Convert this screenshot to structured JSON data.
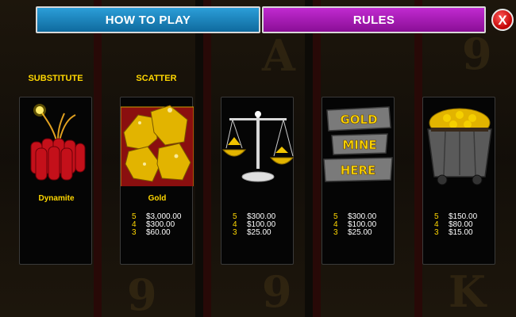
{
  "tabs": {
    "how_to_play": "HOW TO PLAY",
    "rules": "RULES"
  },
  "close_glyph": "X",
  "top_labels": {
    "substitute": "SUBSTITUTE",
    "scatter": "SCATTER"
  },
  "colors": {
    "gold_text": "#ffd700",
    "how_to_play_tab": "#1a86c2",
    "rules_tab": "#a11bb0",
    "close_button": "#d40000"
  },
  "cards": [
    {
      "symbol": "dynamite-icon",
      "name": "Dynamite",
      "pays": []
    },
    {
      "symbol": "gold-nugget-icon",
      "name": "Gold",
      "pays": [
        {
          "count": "5",
          "amount": "$3,000.00"
        },
        {
          "count": "4",
          "amount": "$300.00"
        },
        {
          "count": "3",
          "amount": "$60.00"
        }
      ]
    },
    {
      "symbol": "gold-scale-icon",
      "name": "",
      "pays": [
        {
          "count": "5",
          "amount": "$300.00"
        },
        {
          "count": "4",
          "amount": "$100.00"
        },
        {
          "count": "3",
          "amount": "$25.00"
        }
      ]
    },
    {
      "symbol": "gold-mine-here-sign-icon",
      "name": "",
      "sign_words": [
        "GOLD",
        "MINE",
        "HERE"
      ],
      "pays": [
        {
          "count": "5",
          "amount": "$300.00"
        },
        {
          "count": "4",
          "amount": "$100.00"
        },
        {
          "count": "3",
          "amount": "$25.00"
        }
      ]
    },
    {
      "symbol": "gold-mine-cart-icon",
      "name": "",
      "pays": [
        {
          "count": "5",
          "amount": "$150.00"
        },
        {
          "count": "4",
          "amount": "$80.00"
        },
        {
          "count": "3",
          "amount": "$15.00"
        }
      ]
    }
  ]
}
